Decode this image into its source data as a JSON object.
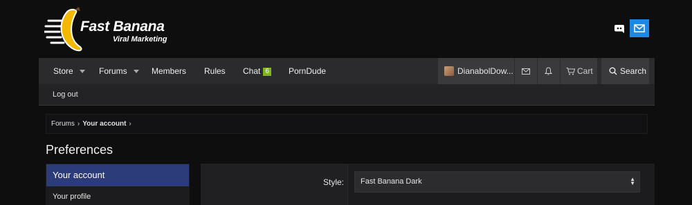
{
  "brand": {
    "title": "Fast Banana",
    "subtitle": "Viral Marketing",
    "accent_color": "#1e88e5",
    "banana_color": "#f5b800"
  },
  "header_icons": [
    {
      "icon": "discord-icon"
    },
    {
      "icon": "mail-icon"
    }
  ],
  "nav": {
    "items": [
      {
        "label": "Store",
        "has_dropdown": true
      },
      {
        "label": "Forums",
        "has_dropdown": true
      },
      {
        "label": "Members"
      },
      {
        "label": "Rules"
      },
      {
        "label": "Chat",
        "badge": "6"
      },
      {
        "label": "PornDude"
      }
    ],
    "username": "DianabolDow...",
    "cart_label": "Cart",
    "search_label": "Search"
  },
  "subnav": {
    "logout_label": "Log out"
  },
  "breadcrumb": {
    "items": [
      "Forums",
      "Your account"
    ]
  },
  "page_title": "Preferences",
  "sidebar": {
    "items": [
      {
        "label": "Your account",
        "active": true
      },
      {
        "label": "Your profile"
      }
    ],
    "active_color": "#2c3b7a"
  },
  "form": {
    "style_label": "Style:",
    "style_value": "Fast Banana Dark"
  },
  "colors": {
    "chat_badge": "#7cb51f"
  }
}
